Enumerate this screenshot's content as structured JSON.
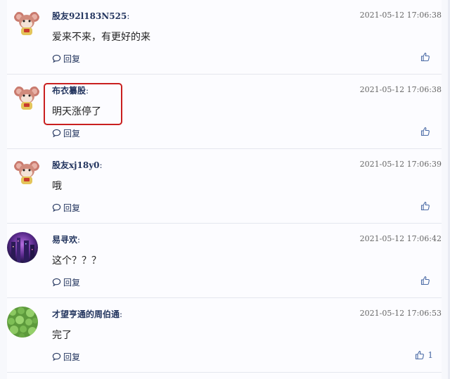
{
  "comments": [
    {
      "username": "股友92l183N525",
      "colon": ":",
      "timestamp": "2021-05-12 17:06:38",
      "text": "爱来不来，有更好的来",
      "reply_label": "回复",
      "likes": "",
      "avatar": "mouse-mascot-icon"
    },
    {
      "username": "布衣纂股",
      "colon": ":",
      "timestamp": "2021-05-12 17:06:38",
      "text": "明天涨停了",
      "reply_label": "回复",
      "likes": "",
      "avatar": "mouse-mascot-icon"
    },
    {
      "username": "股友xj18y0",
      "colon": ":",
      "timestamp": "2021-05-12 17:06:39",
      "text": "哦",
      "reply_label": "回复",
      "likes": "",
      "avatar": "mouse-mascot-icon"
    },
    {
      "username": "易寻欢",
      "colon": ":",
      "timestamp": "2021-05-12 17:06:42",
      "text": "这个？？？",
      "reply_label": "回复",
      "likes": "",
      "avatar": "purple-city-photo"
    },
    {
      "username": "才望亨通的周伯通",
      "colon": ":",
      "timestamp": "2021-05-12 17:06:53",
      "text": "完了",
      "reply_label": "回复",
      "likes": "1",
      "avatar": "green-clover-photo"
    }
  ],
  "highlight_color": "#c91f1f",
  "link_color": "#24365f"
}
